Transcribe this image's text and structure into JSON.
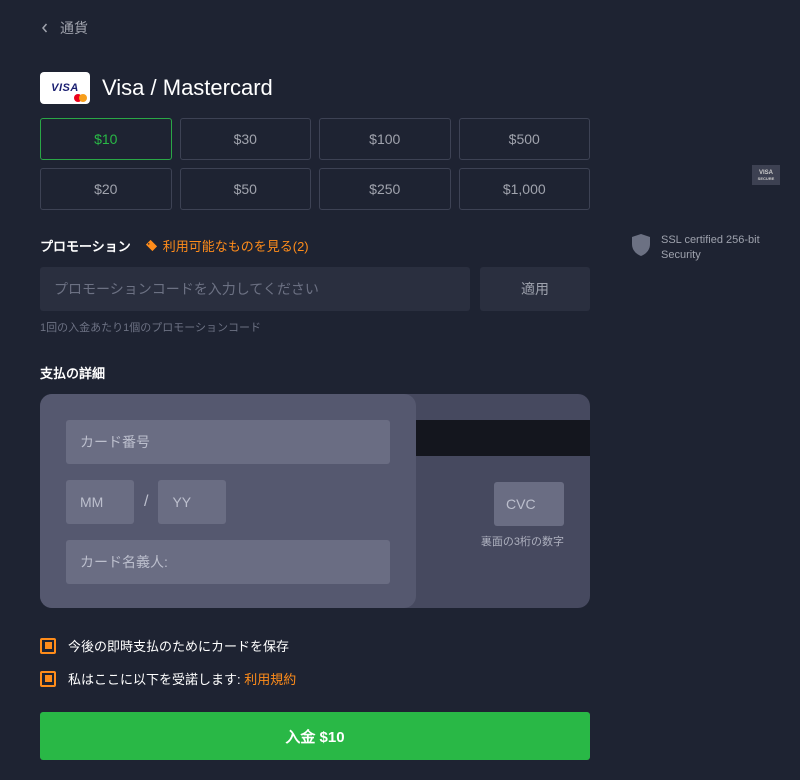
{
  "back": {
    "label": "通貨"
  },
  "title": "Visa / Mastercard",
  "amounts": [
    {
      "label": "$10",
      "selected": true
    },
    {
      "label": "$30",
      "selected": false
    },
    {
      "label": "$100",
      "selected": false
    },
    {
      "label": "$500",
      "selected": false
    },
    {
      "label": "$20",
      "selected": false
    },
    {
      "label": "$50",
      "selected": false
    },
    {
      "label": "$250",
      "selected": false
    },
    {
      "label": "$1,000",
      "selected": false
    }
  ],
  "promo": {
    "section_label": "プロモーション",
    "link_text": "利用可能なものを見る(2)",
    "placeholder": "プロモーションコードを入力してください",
    "apply_label": "適用",
    "helper": "1回の入金あたり1個のプロモーションコード"
  },
  "payment": {
    "section_label": "支払の詳細",
    "card_number_placeholder": "カード番号",
    "mm_placeholder": "MM",
    "yy_placeholder": "YY",
    "cardholder_placeholder": "カード名義人:",
    "cvc_placeholder": "CVC",
    "cvc_hint": "裏面の3桁の数字"
  },
  "checks": {
    "save_card": "今後の即時支払のためにカードを保存",
    "terms_prefix": "私はここに以下を受諾します:",
    "terms_link": "利用規約"
  },
  "deposit": {
    "label": "入金 $10"
  },
  "security": {
    "badge_line1": "VISA",
    "badge_line2": "SECURE",
    "ssl_text": "SSL certified 256-bit Security"
  }
}
